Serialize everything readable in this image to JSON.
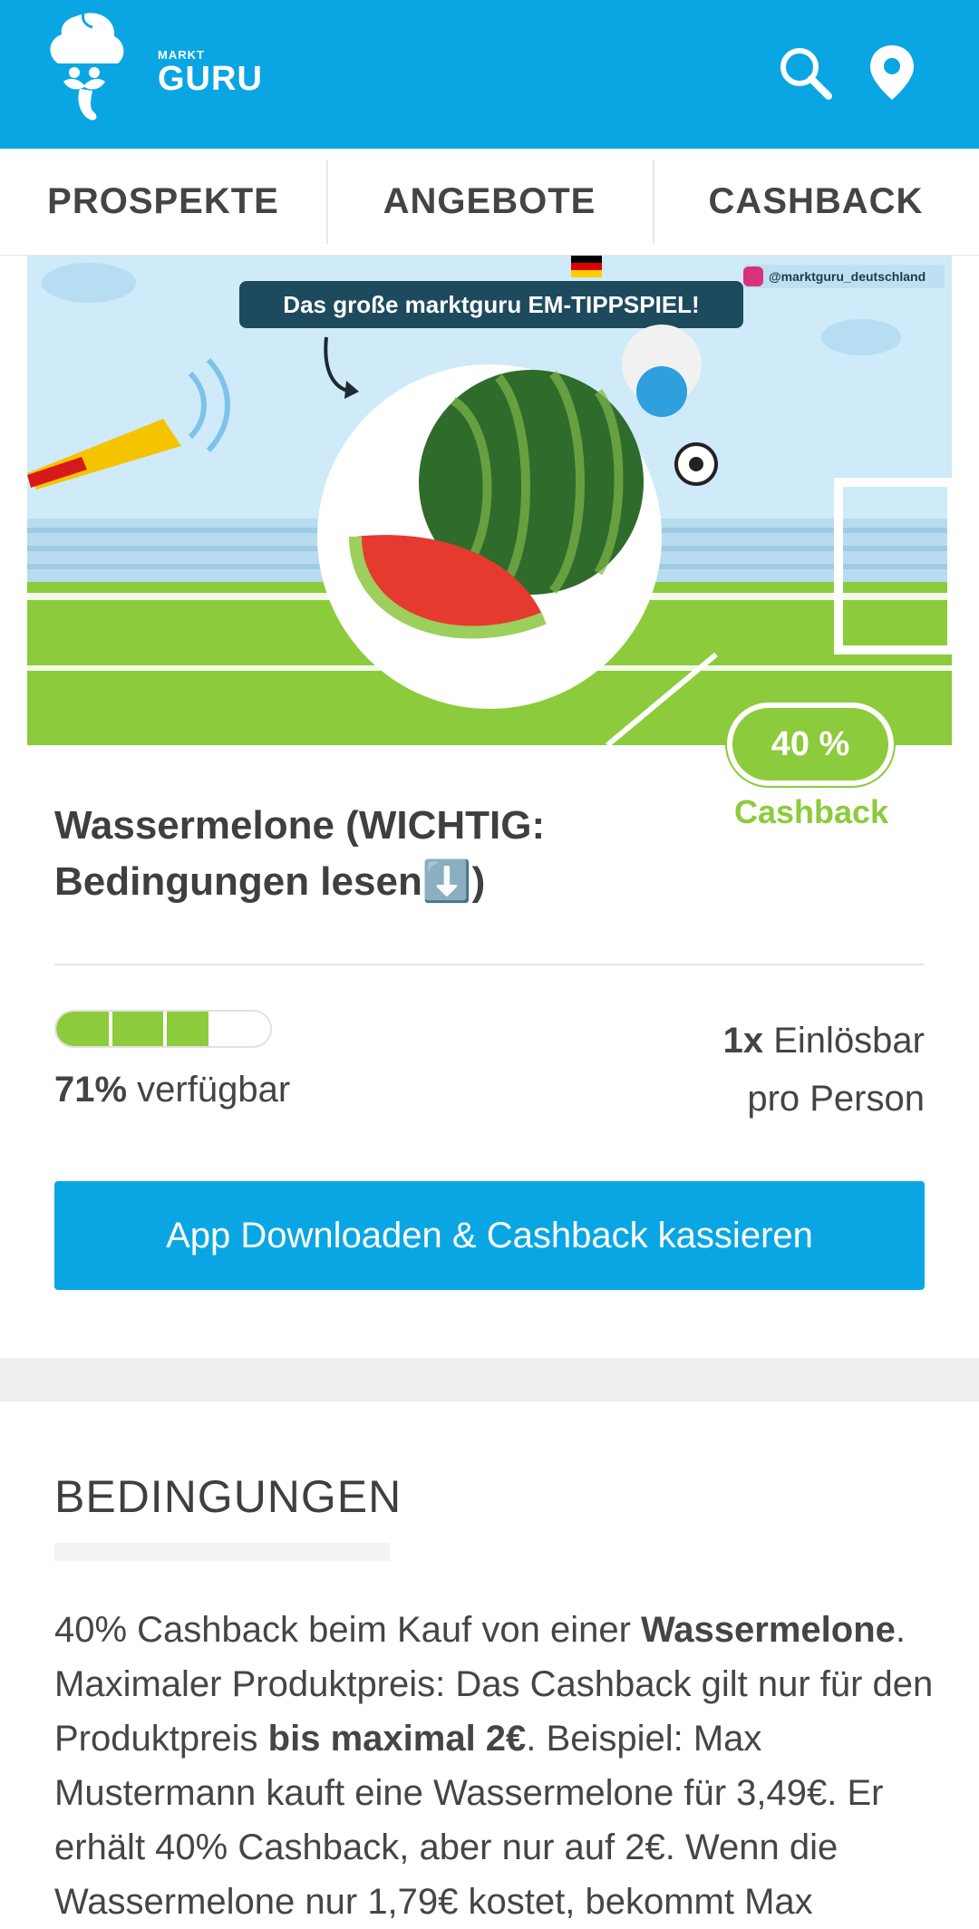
{
  "header": {
    "logo_small": "MARKT",
    "logo_big": "GURU",
    "search_icon": "search-icon",
    "location_icon": "location-pin-icon",
    "color": "#0aa6e4"
  },
  "tabs": [
    {
      "label": "PROSPEKTE"
    },
    {
      "label": "ANGEBOTE"
    },
    {
      "label": "CASHBACK"
    }
  ],
  "banner": {
    "headline": "Das große marktguru EM-TIPPSPIEL!",
    "instagram_handle": "@marktguru_deutschland"
  },
  "offer": {
    "badge_value": "40 %",
    "badge_label": "Cashback",
    "title": "Wassermelone (WICHTIG: Bedingungen lesen⬇️)",
    "available_fraction": 0.71,
    "available_pct": "71%",
    "available_text": " verfügbar",
    "redeem_count": "1x",
    "redeem_text": " Einlösbar",
    "redeem_line2": "pro Person",
    "cta_label": "App Downloaden & Cashback kassieren",
    "accent_green": "#8ccb3b"
  },
  "conditions": {
    "title": "BEDINGUNGEN",
    "p1": "40% Cashback beim Kauf von einer ",
    "p1_bold": "Wassermelone",
    "p2": ". Maximaler Produktpreis: Das Cashback gilt nur für den Produktpreis ",
    "p2_bold": "bis maximal 2€",
    "p3": ". Beispiel: Max Mustermann kauft eine Wassermelone für 3,49€. Er erhält 40% Cashback, aber nur auf 2€. Wenn die Wassermelone nur 1,79€ kostet, bekommt Max"
  }
}
